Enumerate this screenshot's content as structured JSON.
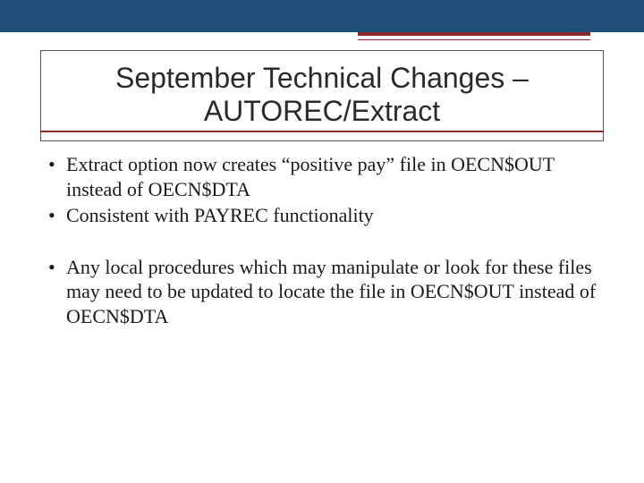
{
  "colors": {
    "band": "#1f4e79",
    "accent": "#8a2a2a"
  },
  "title": {
    "line1": "September Technical Changes –",
    "line2": "AUTOREC/Extract"
  },
  "bullets": {
    "group1": [
      "Extract option now creates “positive pay” file in OECN$OUT instead of OECN$DTA",
      "Consistent with PAYREC functionality"
    ],
    "group2": [
      "Any local procedures which may manipulate or look for these files may need to be updated to locate the file in OECN$OUT instead of OECN$DTA"
    ]
  }
}
